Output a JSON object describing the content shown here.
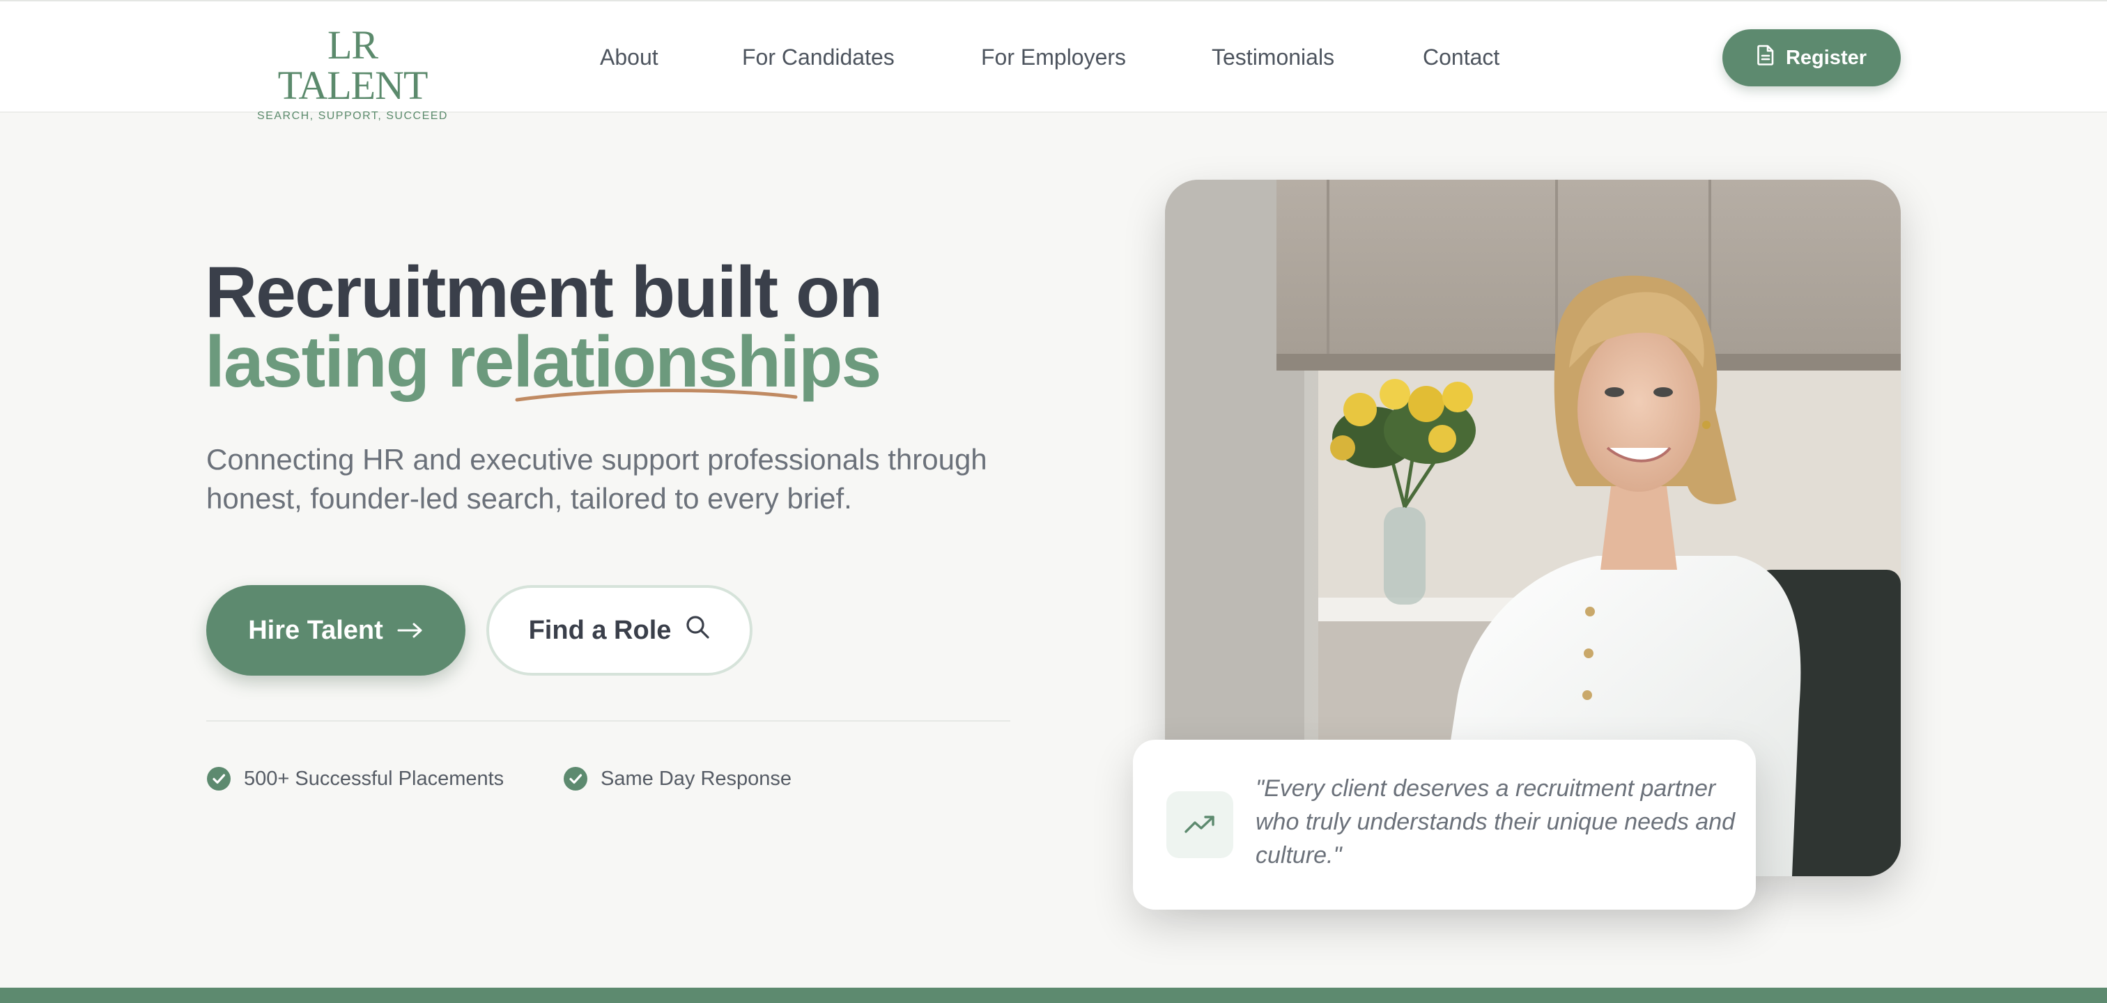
{
  "brand": {
    "name": "LR TALENT",
    "tagline": "SEARCH, SUPPORT, SUCCEED",
    "accent_color": "#5d8a6f",
    "highlight_color": "#6c9a7d",
    "underline_color": "#c08a62"
  },
  "nav": {
    "items": [
      {
        "label": "About"
      },
      {
        "label": "For Candidates"
      },
      {
        "label": "For Employers"
      },
      {
        "label": "Testimonials"
      },
      {
        "label": "Contact"
      }
    ],
    "register": {
      "label": "Register",
      "icon": "document-icon"
    }
  },
  "hero": {
    "title_line1": "Recruitment built on",
    "title_line2": "lasting relationships",
    "subtitle": "Connecting HR and executive support professionals through honest, founder-led search, tailored to every brief.",
    "primary_button": {
      "label": "Hire Talent",
      "icon": "arrow-right-icon"
    },
    "secondary_button": {
      "label": "Find a Role",
      "icon": "search-icon"
    },
    "stats": [
      {
        "label": "500+ Successful Placements",
        "icon": "check-circle-icon"
      },
      {
        "label": "Same Day Response",
        "icon": "check-circle-icon"
      }
    ]
  },
  "quote": {
    "text": "\"Every client deserves a recruitment partner who truly understands their unique needs and culture.\"",
    "icon": "trending-up-icon"
  }
}
